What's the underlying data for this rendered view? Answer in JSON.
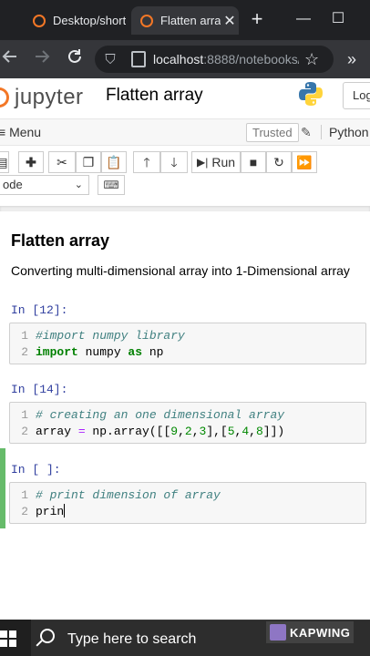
{
  "browser": {
    "tabs": [
      {
        "label": "Desktop/short",
        "active": false
      },
      {
        "label": "Flatten arra",
        "active": true
      }
    ],
    "new_tab_label": "+",
    "window_controls": {
      "minimize": "—",
      "maximize": "☐"
    },
    "url_host": "localhost",
    "url_rest": ":8888/notebooks/",
    "icons": {
      "back": "arrow-left-icon",
      "forward": "arrow-right-icon",
      "reload": "reload-icon",
      "shield": "shield-icon",
      "star": "star-icon",
      "extensions": "double-chevron-icon"
    }
  },
  "jupyter": {
    "logo_text": "jupyter",
    "notebook_title": "Flatten array",
    "logout_label": "Log",
    "menu_label": "Menu",
    "trusted_label": "Trusted",
    "kernel_label": "Python",
    "run_label": "Run",
    "cell_type": "ode",
    "colors": {
      "accent": "#f37726",
      "prompt": "#303f9f",
      "selected": "#66bb6a"
    }
  },
  "notebook": {
    "heading": "Flatten array",
    "paragraph": "Converting multi-dimensional array into 1-Dimensional array",
    "cells": [
      {
        "prompt": "In [12]:",
        "lines": [
          {
            "n": "1",
            "comment": "#import numpy library"
          },
          {
            "n": "2",
            "kw1": "import",
            "mid": " numpy ",
            "kw2": "as",
            "end": " np"
          }
        ]
      },
      {
        "prompt": "In [14]:",
        "lines": [
          {
            "n": "1",
            "comment": "# creating an one dimensional array"
          },
          {
            "n": "2",
            "pre": "array ",
            "op": "=",
            "post": " np.array([[",
            "a1": "9",
            "c1": ",",
            "a2": "2",
            "c2": ",",
            "a3": "3",
            "c3": "],[",
            "a4": "5",
            "c4": ",",
            "a5": "4",
            "c5": ",",
            "a6": "8",
            "c6": "]])"
          }
        ]
      },
      {
        "prompt": "In [ ]:",
        "lines": [
          {
            "n": "1",
            "comment": "# print dimension of array"
          },
          {
            "n": "2",
            "code": "prin"
          }
        ]
      }
    ]
  },
  "taskbar": {
    "search_placeholder": "Type here to search",
    "watermark": "KAPWING"
  }
}
